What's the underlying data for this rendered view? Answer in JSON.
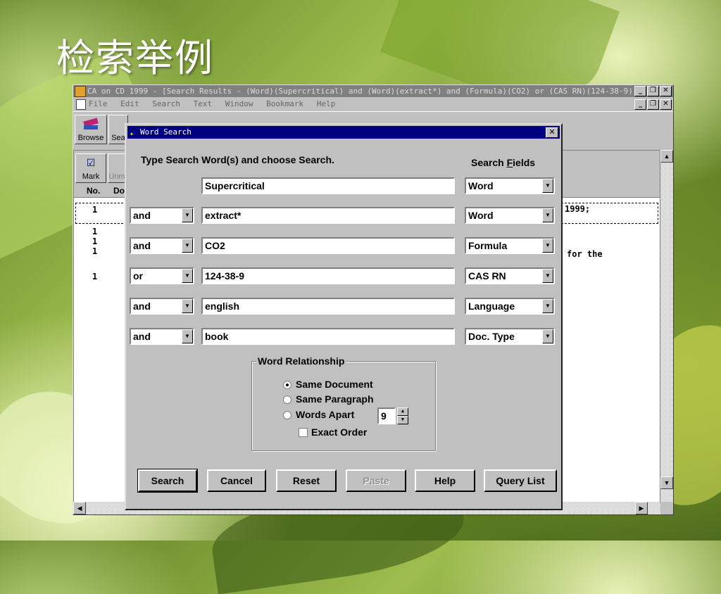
{
  "slide": {
    "title": "检索举例"
  },
  "app": {
    "title": "CA on CD 1999  - [Search Results - (Word)(Supercritical) and (Word)(extract*) and (Formula)(CO2) or (CAS RN)(124-38-9)...",
    "menu": [
      "File",
      "Edit",
      "Search",
      "Text",
      "Window",
      "Bookmark",
      "Help"
    ],
    "toolbar": {
      "browse": "Browse",
      "search": "Sea"
    },
    "results_toolbar": {
      "mark": "Mark",
      "unmark": "Unm"
    },
    "columns": {
      "no": "No.",
      "doc": "Do"
    },
    "rows": [
      "1",
      "1",
      "1",
      "1",
      "1"
    ],
    "snippets": [
      "1999;",
      "for the"
    ]
  },
  "dialog": {
    "title": "Word Search",
    "instruction": "Type Search Word(s) and choose Search.",
    "fields_label": "Search Fields",
    "rows": [
      {
        "op": "",
        "term": "Supercritical",
        "field": "Word"
      },
      {
        "op": "and",
        "term": "extract*",
        "field": "Word"
      },
      {
        "op": "and",
        "term": "CO2",
        "field": "Formula"
      },
      {
        "op": "or",
        "term": "124-38-9",
        "field": "CAS RN"
      },
      {
        "op": "and",
        "term": "english",
        "field": "Language"
      },
      {
        "op": "and",
        "term": "book",
        "field": "Doc. Type"
      }
    ],
    "relationship": {
      "legend": "Word Relationship",
      "same_document": "Same Document",
      "same_paragraph": "Same Paragraph",
      "words_apart": "Words Apart",
      "apart_value": "9",
      "exact_order": "Exact Order",
      "selected": "same_document"
    },
    "buttons": {
      "search": "Search",
      "cancel": "Cancel",
      "reset": "Reset",
      "paste": "Paste",
      "help": "Help",
      "query_list": "Query List"
    }
  }
}
